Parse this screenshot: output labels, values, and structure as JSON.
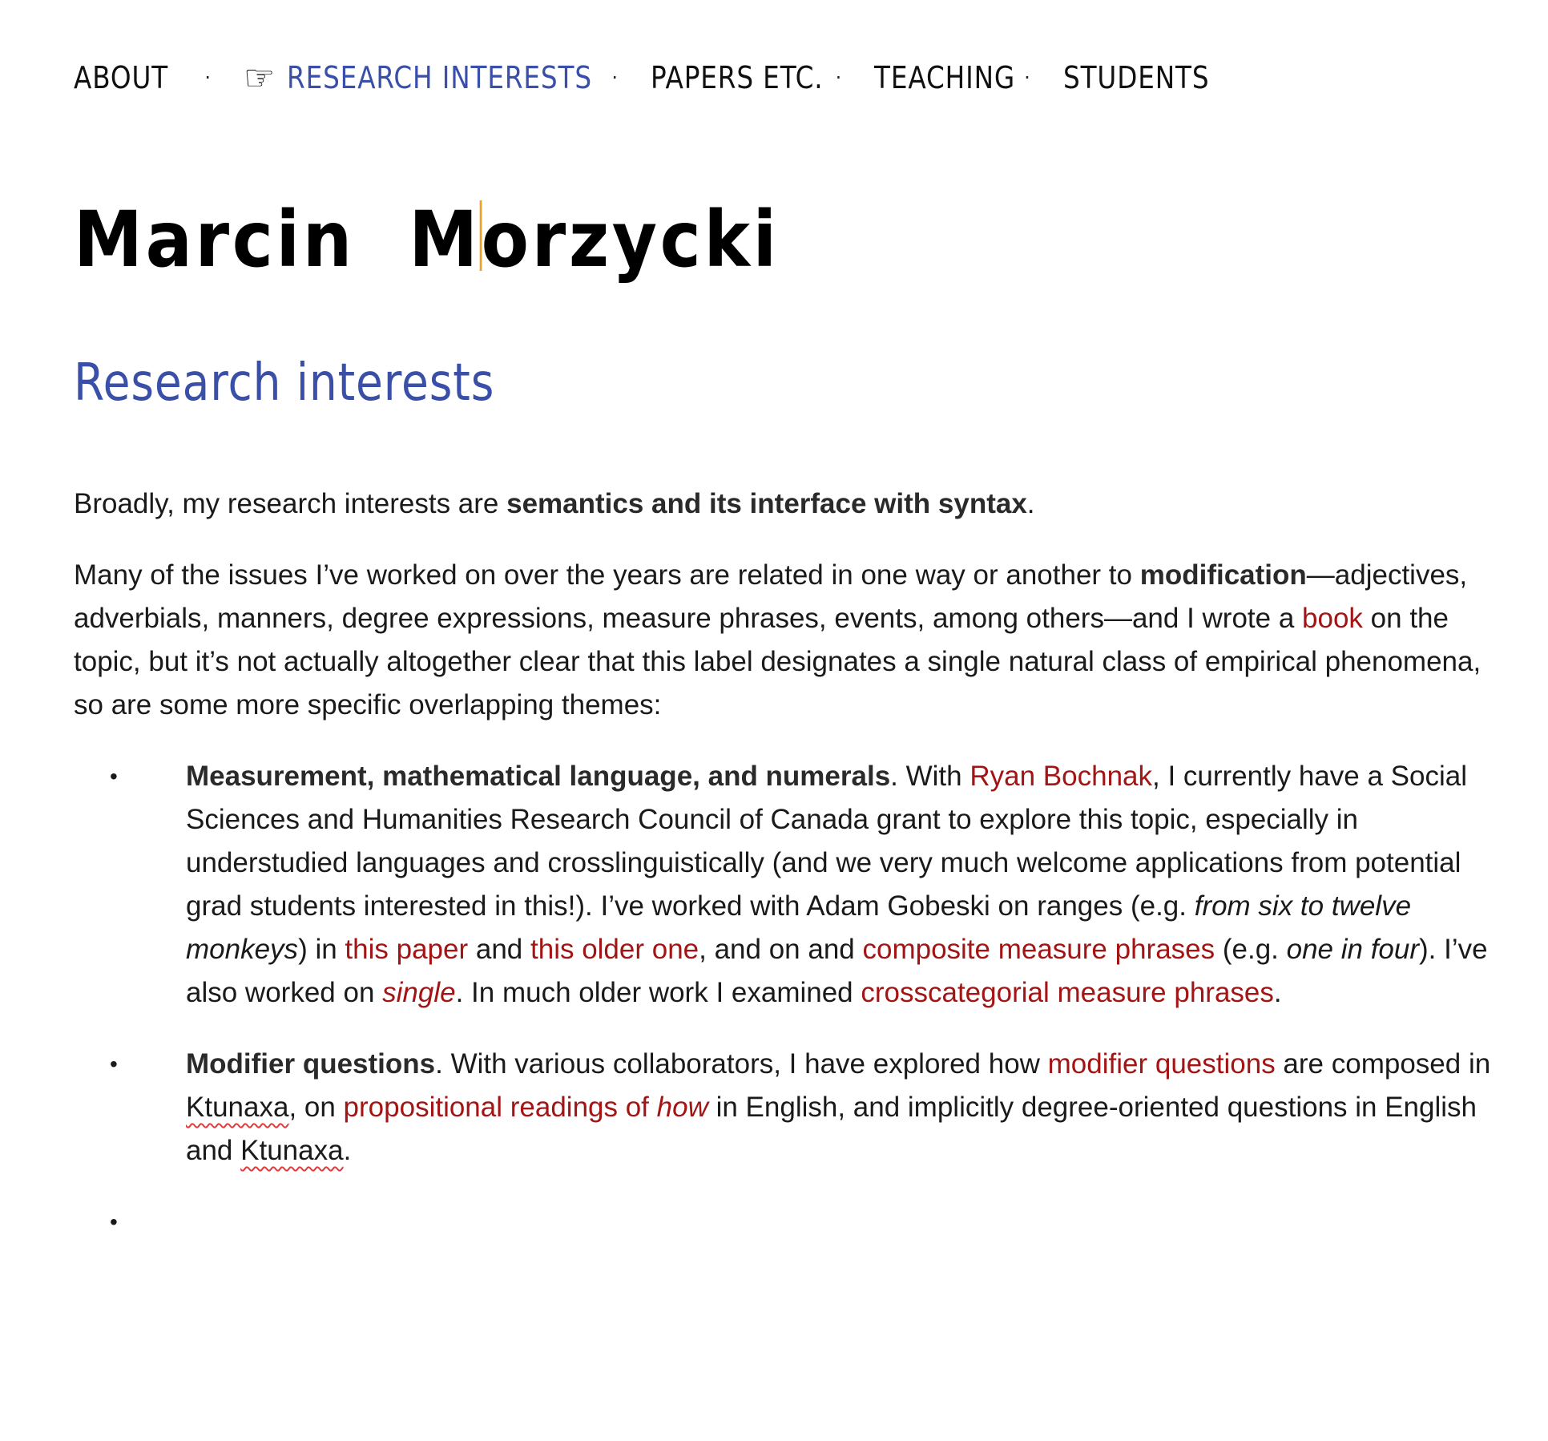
{
  "nav": {
    "items": [
      {
        "label": "ABOUT",
        "active": false
      },
      {
        "label": "RESEARCH INTERESTS",
        "active": true
      },
      {
        "label": "PAPERS ETC.",
        "active": false
      },
      {
        "label": "TEACHING",
        "active": false
      },
      {
        "label": "STUDENTS",
        "active": false
      }
    ],
    "separator": "·",
    "active_marker": "☞"
  },
  "title": {
    "first": "Marcin",
    "last_initial": "M",
    "last_rest": "orzycki"
  },
  "section_heading": "Research interests",
  "intro": {
    "pre": "Broadly, my research interests are ",
    "bold": "semantics and its interface with syntax",
    "post": "."
  },
  "para2": {
    "t1": "Many of the issues I’ve worked on over the years are related in one way or another to ",
    "bold": "modification",
    "t2": "—adjectives, adverbials, manners, degree expressions, measure phrases, events, among others—and I wrote a ",
    "link_book": "book",
    "t3": " on the topic, but it’s not actually altogether clear that this label designates a single natural class of empirical phenomena, so are some more specific overlapping themes:"
  },
  "bullets": {
    "marker": "•",
    "measurement": {
      "bold": "Measurement, mathematical language, and numerals",
      "t1": ". With ",
      "link_ryan": "Ryan Bochnak",
      "t2": ", I currently have a Social Sciences and Humanities Research Council of Canada grant to explore this topic, especially in understudied languages and crosslinguistically (and we very much welcome applications from potential grad students interested in this!). I’ve worked with Adam Gobeski on ranges (e.g. ",
      "italic1": "from six to twelve monkeys",
      "t3": ") in ",
      "link_this_paper": "this paper",
      "t4": " and ",
      "link_older": "this older one",
      "t5": ", and on and ",
      "link_composite": "composite measure phrases",
      "t6": " (e.g. ",
      "italic2": "one in four",
      "t7": "). I’ve also worked on ",
      "link_single": "single",
      "t8": ". In much older work I examined ",
      "link_crosscat": "crosscategorial measure phrases",
      "t9": "."
    },
    "modifier": {
      "bold": "Modifier questions",
      "t1": ". With various collaborators, I have explored how ",
      "link_modq": "modifier questions",
      "t2": " are composed in ",
      "ktunaxa1": "Ktunaxa",
      "t3": ", on ",
      "link_prop": "propositional readings of ",
      "link_prop_italic": "how",
      "t4": " in English, and implicitly degree-oriented questions in English and ",
      "ktunaxa2": "Ktunaxa",
      "t5": "."
    }
  },
  "colors": {
    "accent_blue": "#3a4fa8",
    "link_red": "#a31515",
    "cursor_orange": "#f0a020",
    "spellcheck_red": "#e23b3b"
  }
}
